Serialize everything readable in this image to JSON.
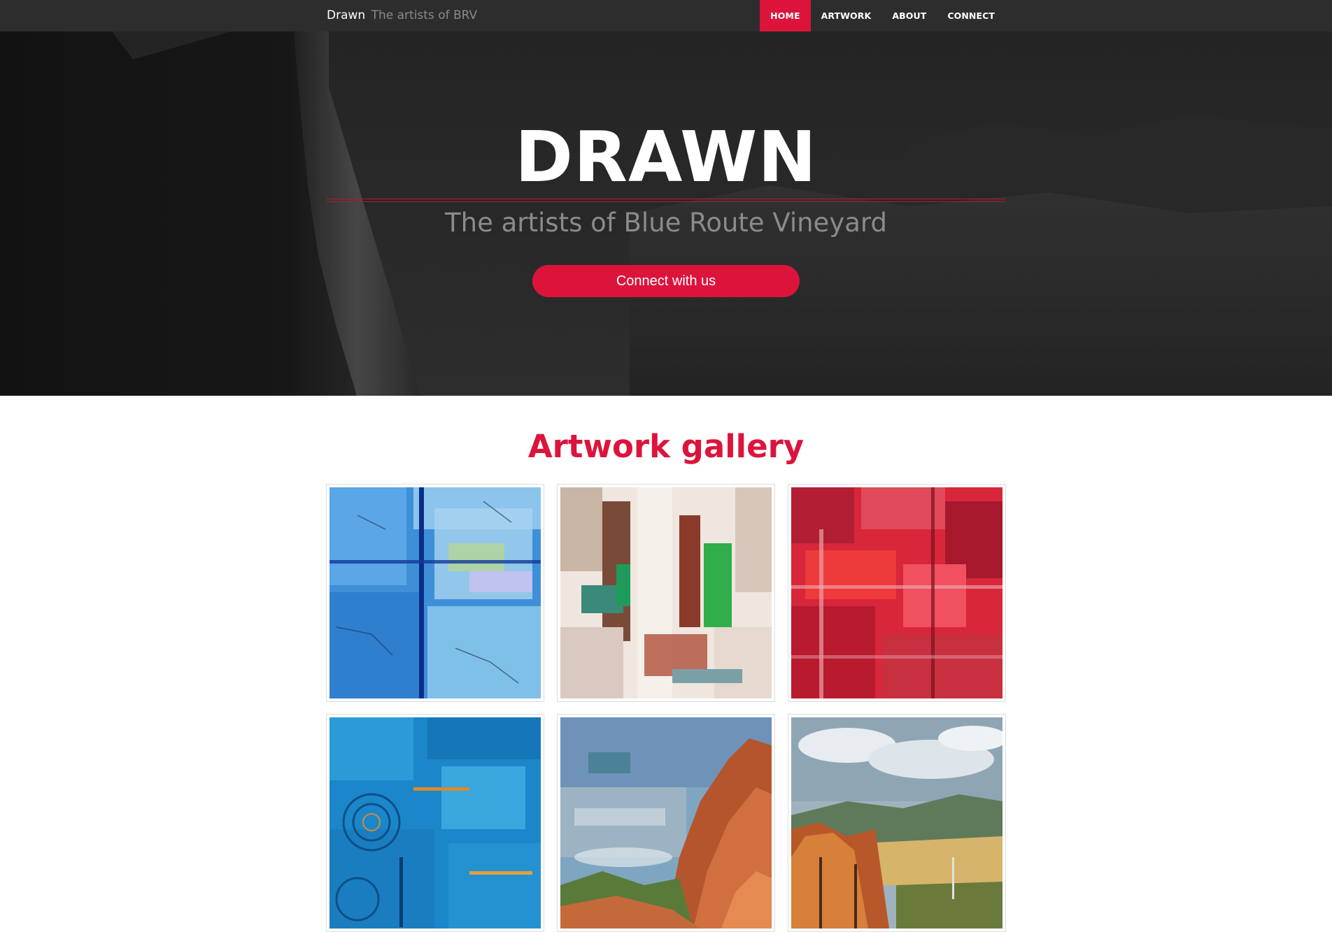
{
  "navbar": {
    "brand": "Drawn",
    "brand_tagline": "The artists of BRV",
    "items": [
      {
        "label": "HOME",
        "active": true
      },
      {
        "label": "ARTWORK",
        "active": false
      },
      {
        "label": "ABOUT",
        "active": false
      },
      {
        "label": "CONNECT",
        "active": false
      }
    ]
  },
  "hero": {
    "title": "DRAWN",
    "subtitle": "The artists of Blue Route Vineyard",
    "cta_label": "Connect with us"
  },
  "gallery": {
    "heading": "Artwork gallery",
    "items": [
      {
        "palette": "blue-cross"
      },
      {
        "palette": "white-green-abstract"
      },
      {
        "palette": "red-crosshatch"
      },
      {
        "palette": "blue-swirls"
      },
      {
        "palette": "red-rock-collage"
      },
      {
        "palette": "autumn-landscape"
      }
    ]
  },
  "colors": {
    "accent": "#dc143c",
    "navbar_bg": "#2d2d2d",
    "subtitle_text": "#8b8b8b"
  }
}
